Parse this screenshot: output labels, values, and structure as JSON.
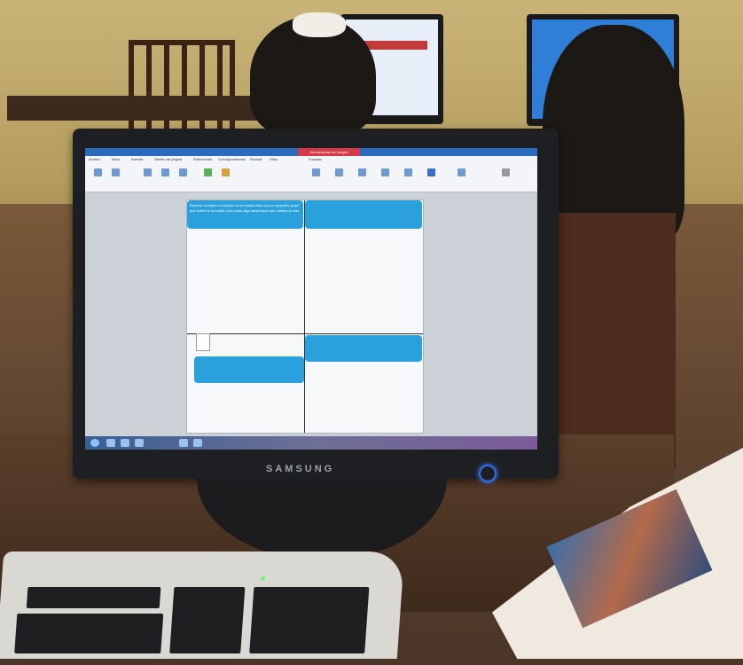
{
  "monitor": {
    "brand": "SAMSUNG"
  },
  "screen": {
    "ribbon_tabs": [
      "Archivo",
      "Inicio",
      "Insertar",
      "Diseño de página",
      "Referencias",
      "Correspondencia",
      "Revisar",
      "Vista",
      "Formato"
    ],
    "context_tab": "Herramientas de imagen",
    "comic_caption": "Roberto va hasta el hospital en un estado fatal con un pequeño golpe que sufrió en la rodilla, pero pasa algo inesperado que cambia la vida"
  },
  "colors": {
    "comic_blue": "#2aa0dc",
    "title_bar": "#2a6bbd",
    "context_tab": "#d63a4a"
  }
}
